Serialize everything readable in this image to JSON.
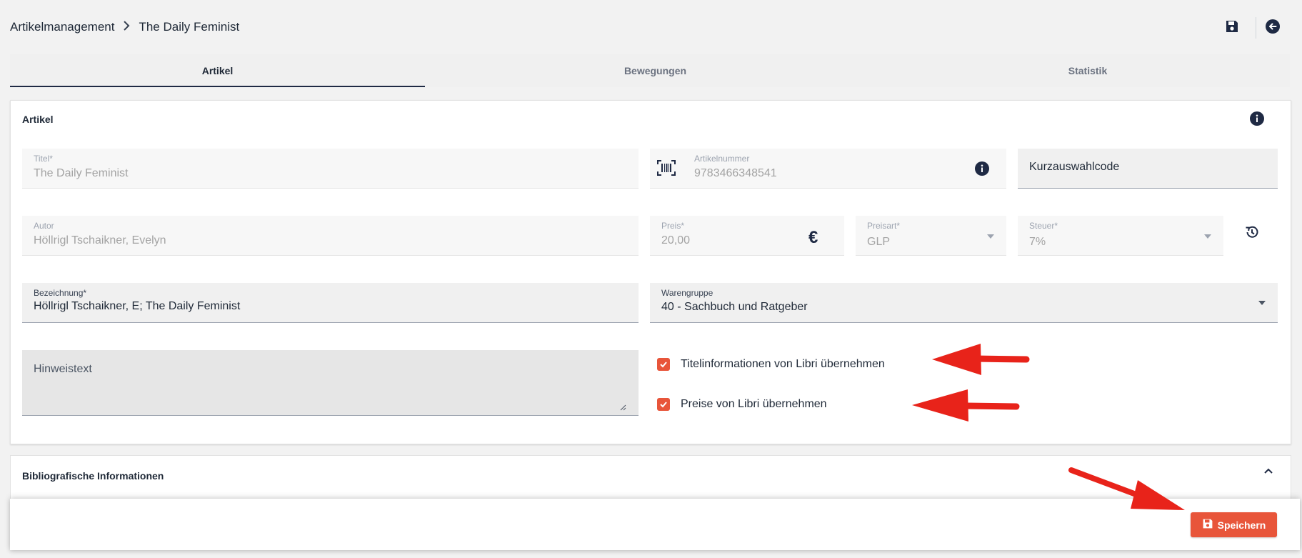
{
  "breadcrumb": {
    "root": "Artikelmanagement",
    "current": "The Daily Feminist"
  },
  "tabs": [
    "Artikel",
    "Bewegungen",
    "Statistik"
  ],
  "card": {
    "title": "Artikel"
  },
  "fields": {
    "titel": {
      "label": "Titel*",
      "value": "The Daily Feminist"
    },
    "artikelnummer": {
      "label": "Artikelnummer",
      "value": "9783466348541"
    },
    "kurzauswahlcode": {
      "placeholder": "Kurzauswahlcode"
    },
    "autor": {
      "label": "Autor",
      "value": "Höllrigl Tschaikner, Evelyn"
    },
    "preis": {
      "label": "Preis*",
      "value": "20,00",
      "currency_symbol": "€"
    },
    "preisart": {
      "label": "Preisart*",
      "value": "GLP"
    },
    "steuer": {
      "label": "Steuer*",
      "value": "7%"
    },
    "bezeichnung": {
      "label": "Bezeichnung*",
      "value": "Höllrigl Tschaikner, E; The Daily Feminist"
    },
    "warengruppe": {
      "label": "Warengruppe",
      "value": "40 - Sachbuch und Ratgeber"
    },
    "hinweistext": {
      "placeholder": "Hinweistext"
    }
  },
  "checkboxes": [
    {
      "label": "Titelinformationen von Libri übernehmen",
      "checked": true
    },
    {
      "label": "Preise von Libri übernehmen",
      "checked": true
    }
  ],
  "section2": {
    "title": "Bibliografische Informationen"
  },
  "footer": {
    "save_label": "Speichern"
  },
  "colors": {
    "accent": "#e8553a",
    "dark": "#1f2a44",
    "annotation_arrow": "#e8231a"
  },
  "icons": [
    "save-icon",
    "back-arrow-icon",
    "info-icon",
    "barcode-icon",
    "euro-icon",
    "history-icon",
    "chevron-up-icon",
    "chevron-right-icon",
    "checkmark-icon"
  ]
}
